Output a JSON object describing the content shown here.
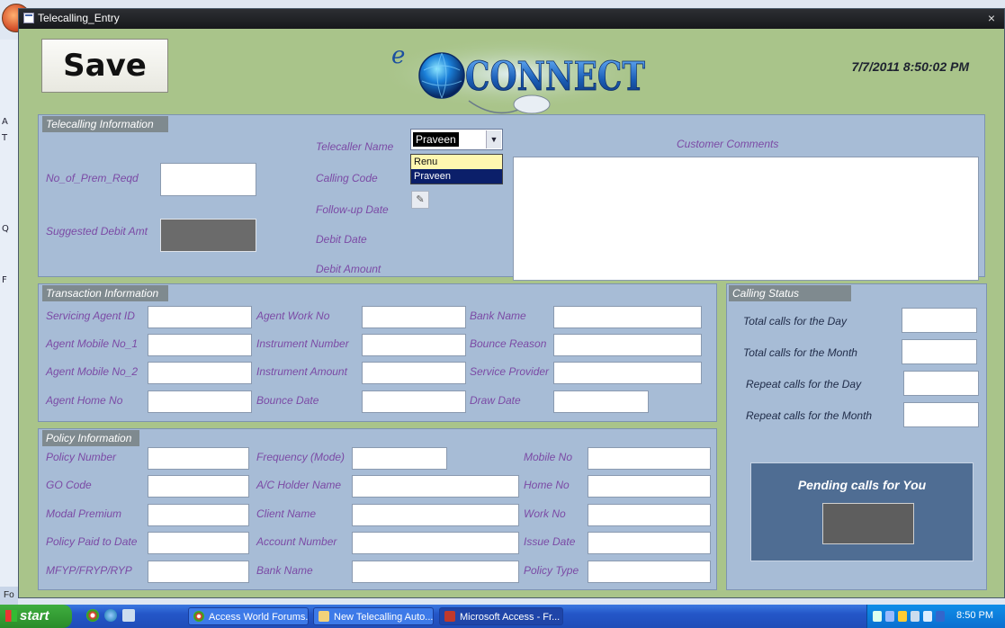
{
  "window": {
    "title": "Telecalling_Entry",
    "close_symbol": "×"
  },
  "toolbar": {
    "save_label": "Save"
  },
  "header": {
    "logo_text": "CONNECT",
    "logo_prefix": "e",
    "datetime": "7/7/2011 8:50:02 PM"
  },
  "background_app": {
    "nav_letters": [
      "A",
      "T",
      "Q",
      "F"
    ],
    "status_text": "Fo"
  },
  "telecalling": {
    "title": "Telecalling Information",
    "no_of_prem_label": "No_of_Prem_Reqd",
    "suggested_debit_label": "Suggested Debit Amt",
    "telecaller_name_label": "Telecaller Name",
    "telecaller_name_value": "Praveen",
    "telecaller_options": [
      "Renu",
      "Praveen"
    ],
    "calling_code_label": "Calling Code",
    "followup_date_label": "Follow-up Date",
    "debit_date_label": "Debit Date",
    "debit_amount_label": "Debit Amount",
    "customer_comments_label": "Customer Comments"
  },
  "transaction": {
    "title": "Transaction Information",
    "col1": [
      "Servicing Agent ID",
      "Agent Mobile No_1",
      "Agent Mobile No_2",
      "Agent Home No"
    ],
    "col2": [
      "Agent Work No",
      "Instrument Number",
      "Instrument Amount",
      "Bounce Date"
    ],
    "col3": [
      "Bank Name",
      "Bounce Reason",
      "Service Provider",
      "Draw Date"
    ]
  },
  "policy": {
    "title": "Policy Information",
    "col1": [
      "Policy Number",
      "GO Code",
      "Modal Premium",
      "Policy Paid to Date",
      "MFYP/FRYP/RYP"
    ],
    "col2": [
      "Frequency (Mode)",
      "A/C Holder Name",
      "Client Name",
      "Account Number",
      "Bank Name"
    ],
    "col3": [
      "Mobile No",
      "Home No",
      "Work No",
      "Issue Date",
      "Policy Type"
    ]
  },
  "calling_status": {
    "title": "Calling Status",
    "items": [
      "Total calls for the Day",
      "Total calls for the Month",
      "Repeat calls for the Day",
      "Repeat calls for the Month"
    ],
    "pending_label": "Pending calls for You"
  },
  "taskbar": {
    "start_label": "start",
    "tasks": [
      "Access World Forums...",
      "New Telecalling Auto...",
      "Microsoft Access - Fr..."
    ],
    "clock": "8:50 PM"
  }
}
